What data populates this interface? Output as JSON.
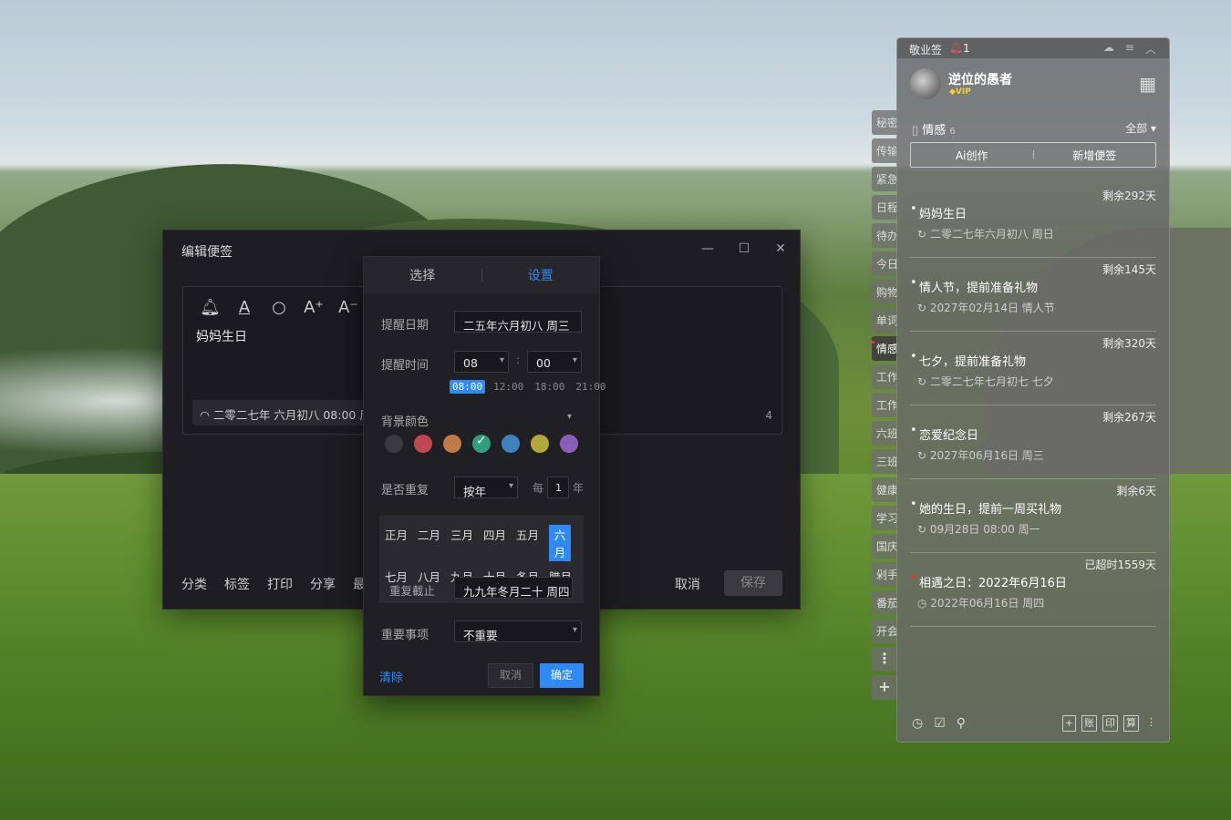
{
  "editor": {
    "title": "编辑便签",
    "win_min": "—",
    "win_max": "☐",
    "win_close": "✕",
    "note_text": "妈妈生日",
    "reminder_chip": "二零二七年 六月初八 08:00 周",
    "char_count": "4",
    "footer": [
      "分类",
      "标签",
      "打印",
      "分享",
      "最"
    ],
    "cancel": "取消",
    "save": "保存"
  },
  "dialog": {
    "tabs": [
      "选择",
      "设置"
    ],
    "active_tab": "设置",
    "remind_date_label": "提醒日期",
    "remind_date_value": "二五年六月初八  周三",
    "remind_time_label": "提醒时间",
    "hour": "08",
    "minute": "00",
    "colon": ":",
    "quick_times": [
      "08:00",
      "12:00",
      "18:00",
      "21:00"
    ],
    "bg_color_label": "背景颜色",
    "colors": [
      "#3b3b3f",
      "#c0474e",
      "#c07a45",
      "#2e9e7e",
      "#3e82c0",
      "#b3a93a",
      "#8a5fb8"
    ],
    "selected_color": "#2e9e7e",
    "repeat_label": "是否重复",
    "repeat_value": "按年",
    "every": "每",
    "every_num": "1",
    "year_unit": "年",
    "months": [
      "正月",
      "二月",
      "三月",
      "四月",
      "五月",
      "六月",
      "七月",
      "八月",
      "九月",
      "十月",
      "冬月",
      "腊月"
    ],
    "active_month": "六月",
    "repeat_end_label": "重复截止",
    "repeat_end_value": "九九年冬月二十  周四",
    "important_label": "重要事项",
    "important_value": "不重要",
    "clear": "清除",
    "cancel": "取消",
    "ok": "确定"
  },
  "sidetabs": [
    "秘密",
    "传输",
    "紧急",
    "日程",
    "待办",
    "今日",
    "购物",
    "单词",
    "情感",
    "工作",
    "工作",
    "六班",
    "三班",
    "健康",
    "学习",
    "国庆",
    "剁手",
    "番茄",
    "开会",
    "⋮",
    "+"
  ],
  "active_sidetab": "情感",
  "panel": {
    "app_name": "敬业签",
    "bell_count": "1",
    "user_name": "逆位的愚者",
    "vip": "◆VIP",
    "category": "情感",
    "category_count": "6",
    "category_filter": "全部 ▾",
    "btn_ai": "Ai创作",
    "btn_new": "新增便签",
    "notes": [
      {
        "remain": "剩余292天",
        "title": "妈妈生日",
        "date": "二零二七年六月初八 周日",
        "over": false
      },
      {
        "remain": "剩余145天",
        "title": "情人节，提前准备礼物",
        "date": "2027年02月14日 情人节",
        "over": false
      },
      {
        "remain": "剩余320天",
        "title": "七夕，提前准备礼物",
        "date": "二零二七年七月初七 七夕",
        "over": false
      },
      {
        "remain": "剩余267天",
        "title": "恋爱纪念日",
        "date": "2027年06月16日 周三",
        "over": false
      },
      {
        "remain": "剩余6天",
        "title": "她的生日，提前一周买礼物",
        "date": "09月28日 08:00 周一",
        "over": false
      },
      {
        "remain": "已超时1559天",
        "title": "相遇之日：2022年6月16日",
        "date": "2022年06月16日 周四",
        "over": true
      }
    ],
    "foot_right": [
      "+",
      "账",
      "印",
      "算"
    ]
  }
}
